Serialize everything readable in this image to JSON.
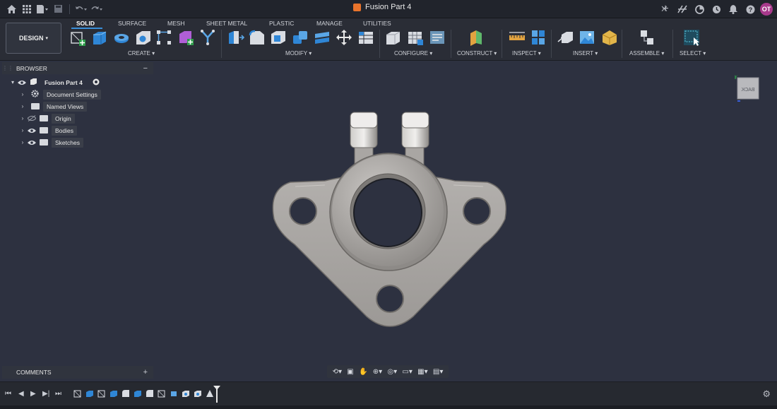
{
  "app": {
    "document_title": "Fusion Part 4"
  },
  "user": {
    "initials": "OT"
  },
  "ribbon": {
    "workspace_button": "DESIGN",
    "tabs": [
      "SOLID",
      "SURFACE",
      "MESH",
      "SHEET METAL",
      "PLASTIC",
      "MANAGE",
      "UTILITIES"
    ],
    "active_tab": "SOLID",
    "groups": [
      "CREATE",
      "MODIFY",
      "CONFIGURE",
      "CONSTRUCT",
      "INSPECT",
      "INSERT",
      "ASSEMBLE",
      "SELECT"
    ]
  },
  "browser": {
    "title": "BROWSER",
    "items": [
      {
        "label": "Fusion Part 4",
        "icon": "component-icon"
      },
      {
        "label": "Document Settings",
        "icon": "gear-icon"
      },
      {
        "label": "Named Views",
        "icon": "folder-icon"
      },
      {
        "label": "Origin",
        "icon": "folder-icon",
        "visible": false
      },
      {
        "label": "Bodies",
        "icon": "folder-icon",
        "visible": true
      },
      {
        "label": "Sketches",
        "icon": "folder-icon",
        "visible": true
      }
    ]
  },
  "viewcube": {
    "face_label": "BACK"
  },
  "comments": {
    "title": "COMMENTS"
  },
  "colors": {
    "background": "#2d3140",
    "accent": "#3a8fd9",
    "part": "#a9a6a3",
    "doc_icon": "#e9742c",
    "avatar": "#a83a8c"
  }
}
